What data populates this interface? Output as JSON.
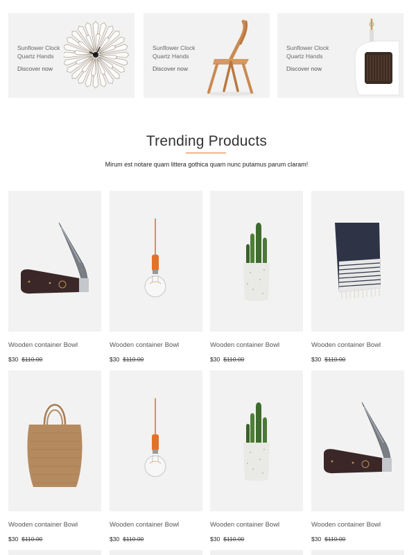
{
  "banners": [
    {
      "line1": "Sunflower Clock",
      "line2": "Quartz Hands",
      "cta": "Discover now",
      "image": "sunflower-clock"
    },
    {
      "line1": "Sunflower Clock",
      "line2": "Quartz Hands",
      "cta": "Discover now",
      "image": "wooden-chair"
    },
    {
      "line1": "Sunflower Clock",
      "line2": "Quartz Hands",
      "cta": "Discover now",
      "image": "dustpan-brush"
    }
  ],
  "trending": {
    "title": "Trending Products",
    "subtitle": "Mirum est notare quam littera gothica quam nunc putamus parum claram!",
    "accent_color": "#e2722b"
  },
  "products": [
    {
      "name": "Wooden container Bowl",
      "price": "$30",
      "old_price": "$110.00",
      "image": "pocket-knife"
    },
    {
      "name": "Wooden container Bowl",
      "price": "$30",
      "old_price": "$110.00",
      "image": "pendant-bulb"
    },
    {
      "name": "Wooden container Bowl",
      "price": "$30",
      "old_price": "$110.00",
      "image": "cactus-pot"
    },
    {
      "name": "Wooden container Bowl",
      "price": "$30",
      "old_price": "$110.00",
      "image": "striped-towel"
    },
    {
      "name": "Wooden container Bowl",
      "price": "$30",
      "old_price": "$110.00",
      "image": "jute-bag"
    },
    {
      "name": "Wooden container Bowl",
      "price": "$30",
      "old_price": "$110.00",
      "image": "pendant-bulb"
    },
    {
      "name": "Wooden container Bowl",
      "price": "$30",
      "old_price": "$110.00",
      "image": "cactus-pot"
    },
    {
      "name": "Wooden container Bowl",
      "price": "$30",
      "old_price": "$110.00",
      "image": "pocket-knife"
    }
  ]
}
